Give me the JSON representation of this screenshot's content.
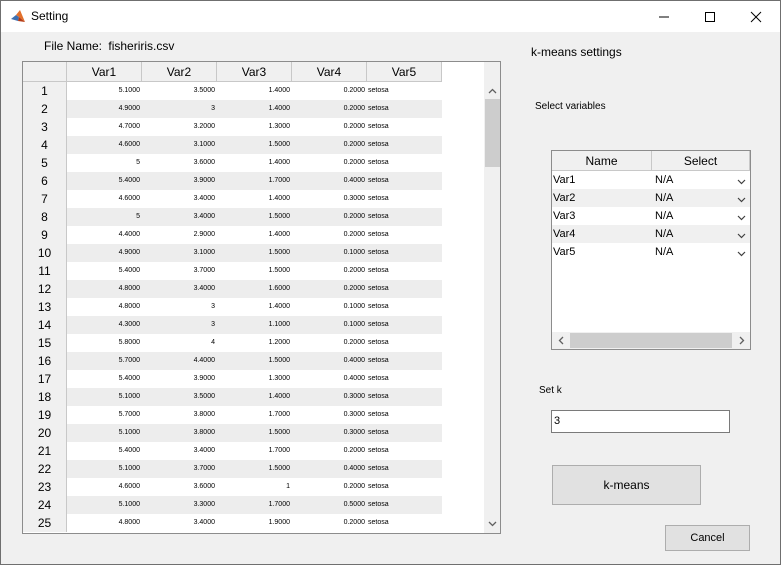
{
  "window": {
    "title": "Setting"
  },
  "file": {
    "label": "File Name:",
    "name": "fisheriris.csv"
  },
  "table": {
    "columns": [
      "Var1",
      "Var2",
      "Var3",
      "Var4",
      "Var5"
    ],
    "rows": [
      [
        "1",
        "5.1000",
        "3.5000",
        "1.4000",
        "0.2000",
        "setosa"
      ],
      [
        "2",
        "4.9000",
        "3",
        "1.4000",
        "0.2000",
        "setosa"
      ],
      [
        "3",
        "4.7000",
        "3.2000",
        "1.3000",
        "0.2000",
        "setosa"
      ],
      [
        "4",
        "4.6000",
        "3.1000",
        "1.5000",
        "0.2000",
        "setosa"
      ],
      [
        "5",
        "5",
        "3.6000",
        "1.4000",
        "0.2000",
        "setosa"
      ],
      [
        "6",
        "5.4000",
        "3.9000",
        "1.7000",
        "0.4000",
        "setosa"
      ],
      [
        "7",
        "4.6000",
        "3.4000",
        "1.4000",
        "0.3000",
        "setosa"
      ],
      [
        "8",
        "5",
        "3.4000",
        "1.5000",
        "0.2000",
        "setosa"
      ],
      [
        "9",
        "4.4000",
        "2.9000",
        "1.4000",
        "0.2000",
        "setosa"
      ],
      [
        "10",
        "4.9000",
        "3.1000",
        "1.5000",
        "0.1000",
        "setosa"
      ],
      [
        "11",
        "5.4000",
        "3.7000",
        "1.5000",
        "0.2000",
        "setosa"
      ],
      [
        "12",
        "4.8000",
        "3.4000",
        "1.6000",
        "0.2000",
        "setosa"
      ],
      [
        "13",
        "4.8000",
        "3",
        "1.4000",
        "0.1000",
        "setosa"
      ],
      [
        "14",
        "4.3000",
        "3",
        "1.1000",
        "0.1000",
        "setosa"
      ],
      [
        "15",
        "5.8000",
        "4",
        "1.2000",
        "0.2000",
        "setosa"
      ],
      [
        "16",
        "5.7000",
        "4.4000",
        "1.5000",
        "0.4000",
        "setosa"
      ],
      [
        "17",
        "5.4000",
        "3.9000",
        "1.3000",
        "0.4000",
        "setosa"
      ],
      [
        "18",
        "5.1000",
        "3.5000",
        "1.4000",
        "0.3000",
        "setosa"
      ],
      [
        "19",
        "5.7000",
        "3.8000",
        "1.7000",
        "0.3000",
        "setosa"
      ],
      [
        "20",
        "5.1000",
        "3.8000",
        "1.5000",
        "0.3000",
        "setosa"
      ],
      [
        "21",
        "5.4000",
        "3.4000",
        "1.7000",
        "0.2000",
        "setosa"
      ],
      [
        "22",
        "5.1000",
        "3.7000",
        "1.5000",
        "0.4000",
        "setosa"
      ],
      [
        "23",
        "4.6000",
        "3.6000",
        "1",
        "0.2000",
        "setosa"
      ],
      [
        "24",
        "5.1000",
        "3.3000",
        "1.7000",
        "0.5000",
        "setosa"
      ],
      [
        "25",
        "4.8000",
        "3.4000",
        "1.9000",
        "0.2000",
        "setosa"
      ]
    ]
  },
  "kmeans_settings": {
    "title": "k-means settings",
    "select_label": "Select variables",
    "var_table": {
      "headers": [
        "Name",
        "Select"
      ],
      "rows": [
        {
          "name": "Var1",
          "select": "N/A"
        },
        {
          "name": "Var2",
          "select": "N/A"
        },
        {
          "name": "Var3",
          "select": "N/A"
        },
        {
          "name": "Var4",
          "select": "N/A"
        },
        {
          "name": "Var5",
          "select": "N/A"
        }
      ]
    },
    "setk_label": "Set k",
    "k_value": "3",
    "run_label": "k-means"
  },
  "cancel_label": "Cancel"
}
